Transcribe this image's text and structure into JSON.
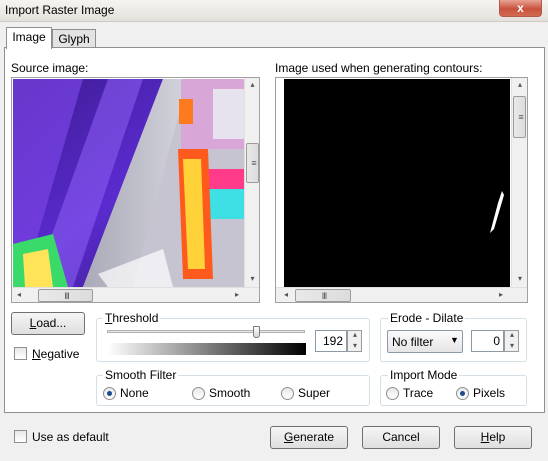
{
  "window": {
    "title": "Import Raster Image",
    "close_glyph": "x"
  },
  "tabs": [
    {
      "label": "Image",
      "active": true
    },
    {
      "label": "Glyph",
      "active": false
    }
  ],
  "source": {
    "label": "Source image:"
  },
  "contour": {
    "label": "Image used when generating contours:"
  },
  "scroll": {
    "left": "◂",
    "right": "▸",
    "up": "▴",
    "down": "▾",
    "grip_h": "III",
    "grip_v": "≡"
  },
  "load_button": {
    "first": "L",
    "rest": "oad..."
  },
  "negative": {
    "first": "N",
    "rest": "egative",
    "checked": false
  },
  "threshold": {
    "first": "T",
    "rest": "hreshold",
    "value": "192",
    "level_fraction": 0.75
  },
  "erode": {
    "label": "Erode - Dilate",
    "filter": "No filter",
    "value": "0"
  },
  "smooth": {
    "label": "Smooth Filter",
    "options": [
      "None",
      "Smooth",
      "Super"
    ],
    "selected": "None"
  },
  "import_mode": {
    "label": "Import Mode",
    "options": [
      "Trace",
      "Pixels"
    ],
    "selected": "Pixels"
  },
  "use_default": {
    "label": "Use as default",
    "checked": false
  },
  "buttons": {
    "generate": {
      "first": "G",
      "rest": "enerate"
    },
    "cancel": {
      "label": "Cancel"
    },
    "help": {
      "first": "H",
      "rest": "elp"
    }
  },
  "colors": {
    "accent_radio": "#1d4b8f",
    "close": "#c8533d"
  }
}
